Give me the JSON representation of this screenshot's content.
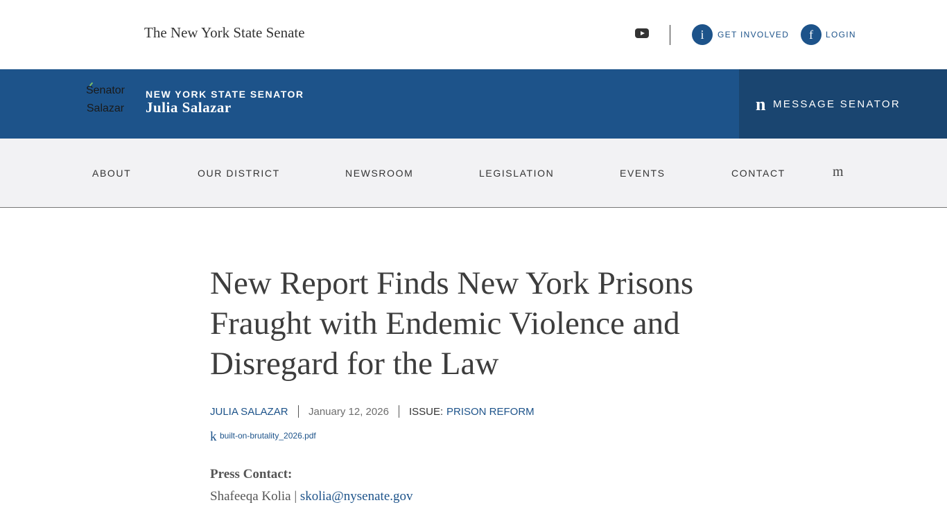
{
  "topbar": {
    "site_title": "The New York State Senate",
    "youtube_icon": "youtube-icon",
    "get_involved": {
      "icon_glyph": "i",
      "label": "GET INVOLVED"
    },
    "login": {
      "icon_glyph": "f",
      "label": "LOGIN"
    }
  },
  "banner": {
    "avatar_alt": "Senator Salazar",
    "label": "NEW YORK STATE SENATOR",
    "name": "Julia Salazar",
    "message": {
      "icon_glyph": "n",
      "label": "MESSAGE SENATOR"
    }
  },
  "nav": {
    "items": [
      "ABOUT",
      "OUR DISTRICT",
      "NEWSROOM",
      "LEGISLATION",
      "EVENTS",
      "CONTACT"
    ],
    "search_glyph": "m"
  },
  "article": {
    "headline": "New Report Finds New York Prisons Fraught with Endemic Violence and Disregard for the Law",
    "author": "JULIA SALAZAR",
    "date": "January 12, 2026",
    "issue_label": "ISSUE:",
    "issue": "PRISON REFORM",
    "file_glyph": "k",
    "file_name": "built-on-brutality_2026.pdf",
    "press_contact_label": "Press Contact:",
    "press_contact_name": "Shafeeqa Kolia",
    "press_contact_sep": "|",
    "press_contact_email": "skolia@nysenate.gov"
  },
  "colors": {
    "brand_blue": "#1d538a",
    "dark_blue": "#1a4570",
    "nav_bg": "#f2f2f4"
  }
}
